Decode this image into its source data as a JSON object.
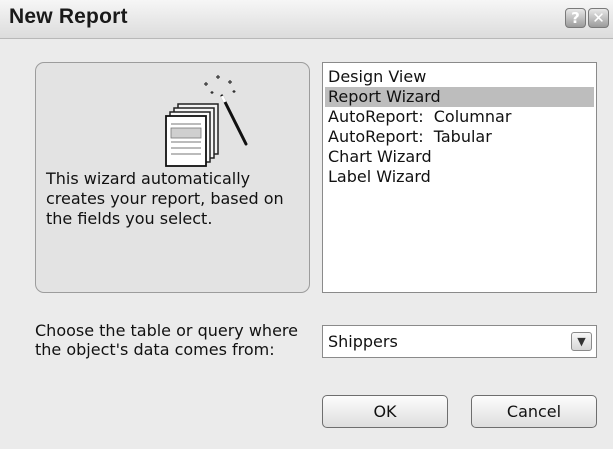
{
  "window": {
    "title": "New Report",
    "help_label": "?",
    "close_label": "✕"
  },
  "illustration": {
    "icon": "report-wizard-icon",
    "description": "This wizard automatically creates your report, based on the fields you select."
  },
  "report_types": {
    "items": [
      {
        "label": "Design View",
        "selected": false
      },
      {
        "label": "Report Wizard",
        "selected": true
      },
      {
        "label": "AutoReport:  Columnar",
        "selected": false
      },
      {
        "label": "AutoReport:  Tabular",
        "selected": false
      },
      {
        "label": "Chart Wizard",
        "selected": false
      },
      {
        "label": "Label Wizard",
        "selected": false
      }
    ]
  },
  "source": {
    "prompt": "Choose the table or query where the object's data comes from:",
    "value": "Shippers",
    "dropdown_icon": "chevron-down-icon"
  },
  "buttons": {
    "ok": "OK",
    "cancel": "Cancel"
  },
  "colors": {
    "dialog_bg": "#ebebeb",
    "selection": "#bdbdbd"
  }
}
